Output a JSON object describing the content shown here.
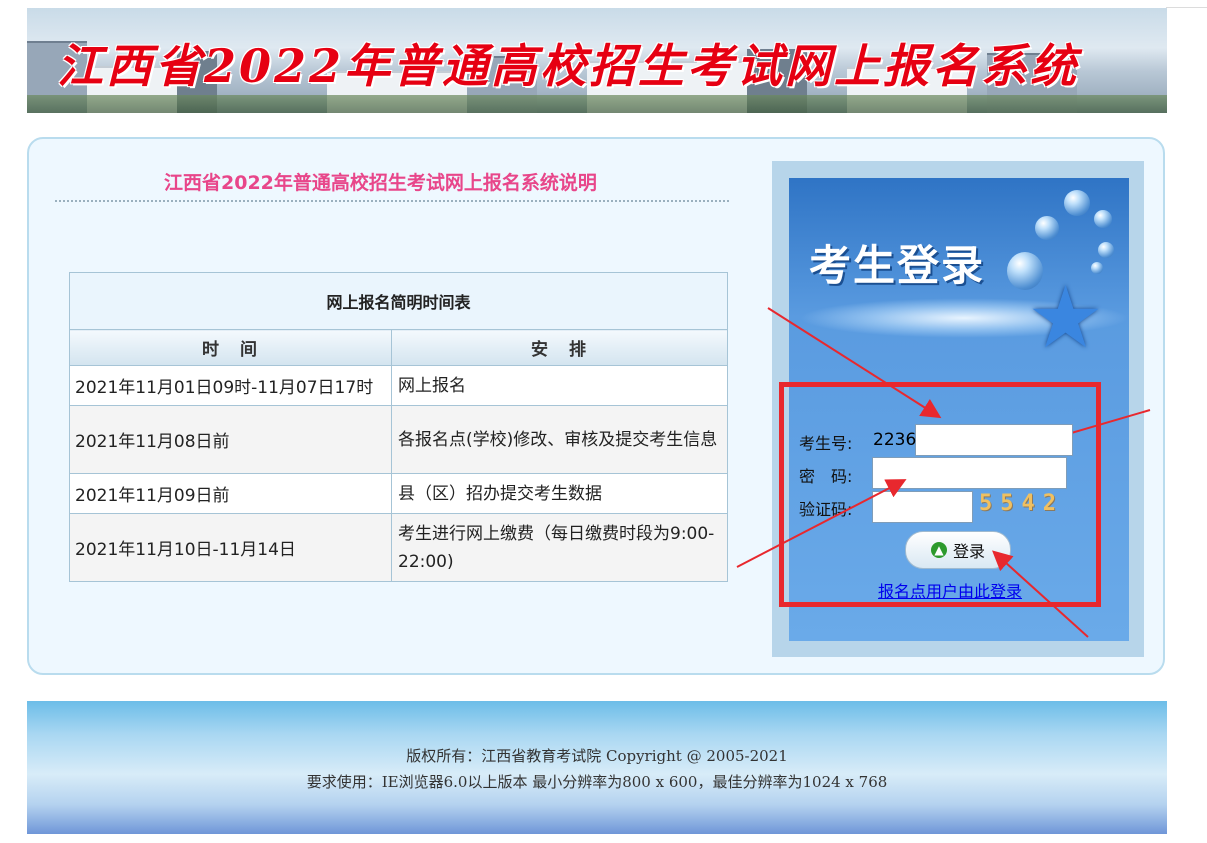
{
  "banner": {
    "title": "江西省2022年普通高校招生考试网上报名系统"
  },
  "info": {
    "title": "江西省2022年普通高校招生考试网上报名系统说明",
    "table": {
      "caption": "网上报名简明时间表",
      "headers": [
        "时　间",
        "安　排"
      ],
      "rows": [
        {
          "time": "2021年11月01日09时-11月07日17时",
          "task": "网上报名"
        },
        {
          "time": "2021年11月08日前",
          "task": "各报名点(学校)修改、审核及提交考生信息"
        },
        {
          "time": "2021年11月09日前",
          "task": "县（区）招办提交考生数据"
        },
        {
          "time": "2021年11月10日-11月14日",
          "task": "考生进行网上缴费（每日缴费时段为9:00-22:00)"
        }
      ]
    }
  },
  "login": {
    "title": "考生登录",
    "examinee_label": "考生号:",
    "examinee_value": "2236",
    "password_label": "密　码:",
    "password_value": "",
    "captcha_label": "验证码:",
    "captcha_value": "",
    "captcha_code": "5542",
    "submit_label": "登录",
    "site_link": "报名点用户由此登录"
  },
  "footer": {
    "line1": "版权所有：江西省教育考试院 Copyright @ 2005-2021",
    "line2": "要求使用：IE浏览器6.0以上版本 最小分辨率为800 x 600，最佳分辨率为1024 x 768"
  },
  "colors": {
    "info_title": "#e8468a",
    "banner_title": "#e60012",
    "annotation": "#e8282e",
    "login_bg": "#5a9be0"
  },
  "icons": {
    "submit": "up-arrow-icon",
    "decoration": "star-icon"
  }
}
